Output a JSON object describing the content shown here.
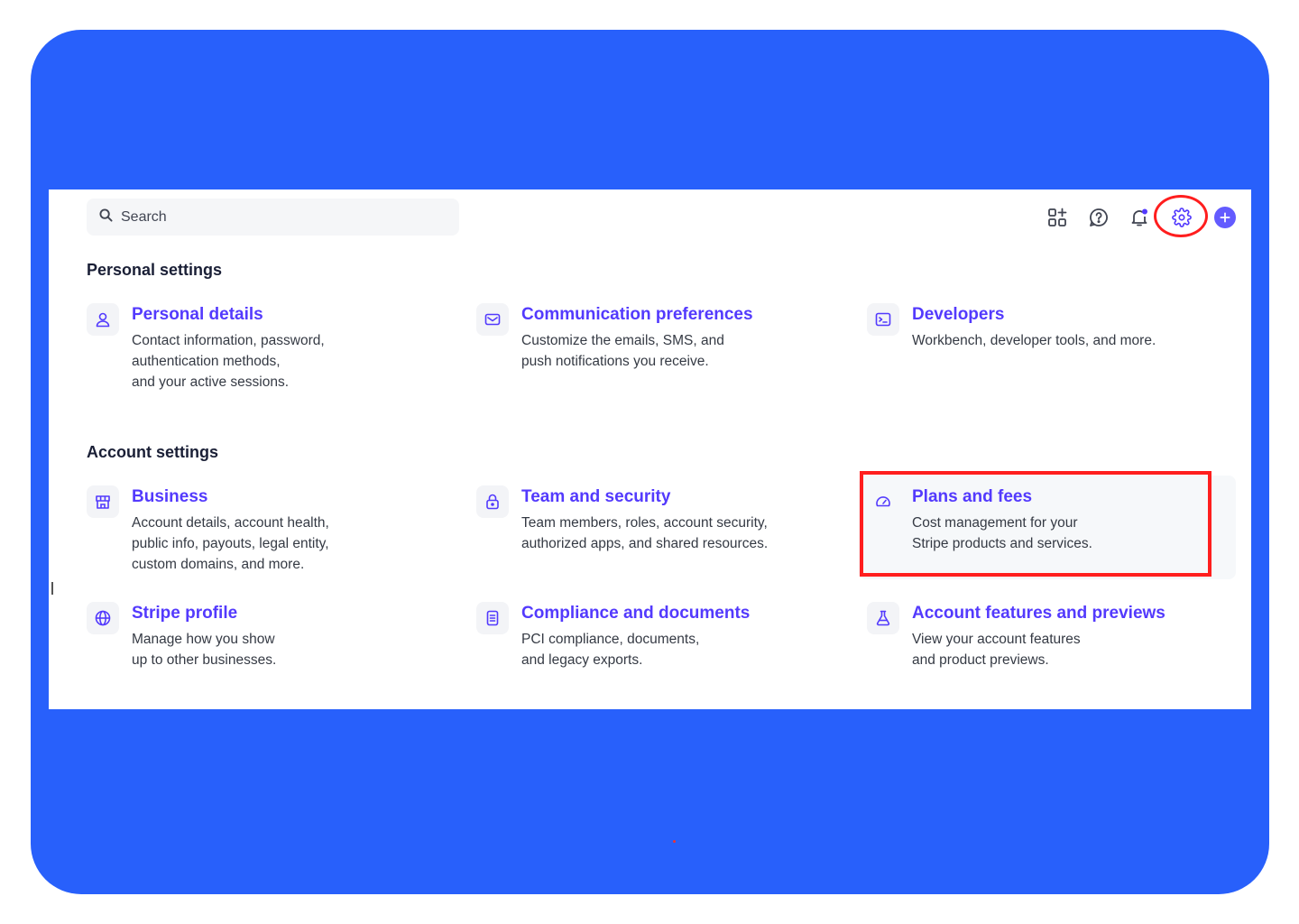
{
  "search": {
    "placeholder": "Search",
    "icon": "search-icon"
  },
  "toolbar": {
    "icons": [
      "apps-icon",
      "help-icon",
      "bell-icon",
      "gear-icon",
      "plus-icon"
    ],
    "notification_dot_color": "#533afd",
    "highlight_color": "#ff1e1e"
  },
  "personal": {
    "title": "Personal settings",
    "cards": [
      {
        "title": "Personal details",
        "lines": [
          "Contact information, password,",
          "authentication methods,",
          "and your active sessions."
        ],
        "icon": "user-icon"
      },
      {
        "title": "Communication preferences",
        "lines": [
          "Customize the emails, SMS, and",
          "push notifications you receive."
        ],
        "icon": "mail-icon"
      },
      {
        "title": "Developers",
        "lines": [
          "Workbench, developer tools, and more."
        ],
        "icon": "terminal-icon"
      }
    ]
  },
  "account": {
    "title": "Account settings",
    "cards": [
      {
        "title": "Business",
        "lines": [
          "Account details, account health,",
          "public info, payouts, legal entity,",
          "custom domains, and more."
        ],
        "icon": "store-icon"
      },
      {
        "title": "Team and security",
        "lines": [
          "Team members, roles, account security,",
          "authorized apps, and shared resources."
        ],
        "icon": "lock-icon"
      },
      {
        "title": "Plans and fees",
        "lines": [
          "Cost management for your",
          "Stripe products and services."
        ],
        "icon": "gauge-icon"
      },
      {
        "title": "Stripe profile",
        "lines": [
          "Manage how you show",
          "up to other businesses."
        ],
        "icon": "globe-icon"
      },
      {
        "title": "Compliance and documents",
        "lines": [
          "PCI compliance, documents,",
          "and legacy exports."
        ],
        "icon": "document-icon"
      },
      {
        "title": "Account features and previews",
        "lines": [
          "View your account features",
          "and product previews."
        ],
        "icon": "flask-icon"
      }
    ]
  },
  "colors": {
    "frame": "#2860fb",
    "accent": "#533afd",
    "text": "#353a44"
  }
}
